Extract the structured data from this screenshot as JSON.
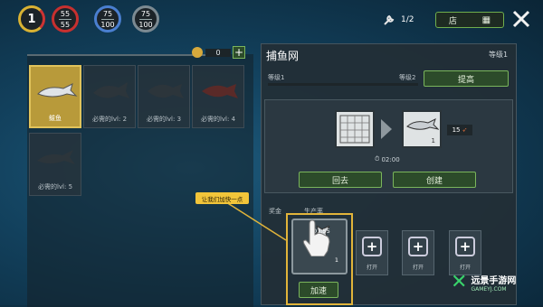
{
  "stats": {
    "level": "1",
    "health": {
      "current": "55",
      "max": "55"
    },
    "food": {
      "current": "75",
      "max": "100"
    },
    "water": {
      "current": "75",
      "max": "100"
    }
  },
  "top": {
    "tools_count": "1/2",
    "store_label": "店"
  },
  "inventory": {
    "coins": "0",
    "items": [
      {
        "label": "鲅鱼",
        "selected": true
      },
      {
        "label": "必需的lvl:  2",
        "selected": false
      },
      {
        "label": "必需的lvl:  3",
        "selected": false
      },
      {
        "label": "必需的lvl:  4",
        "selected": false
      },
      {
        "label": "必需的lvl:  5",
        "selected": false
      }
    ]
  },
  "craft": {
    "title": "捕鱼网",
    "level_badge": "等级1",
    "level1_label": "等级1",
    "level2_label": "等级2",
    "upgrade_button": "提高",
    "output_qty": "1",
    "output_count": "15",
    "timer": "02:00",
    "back_button": "回去",
    "create_button": "创建",
    "sub_left": "奖金",
    "sub_mid": "生产率",
    "active_slot": {
      "timer": "01:55",
      "qty": "1"
    },
    "open_label": "打开",
    "speedup_button": "加速"
  },
  "tooltip": "让我们加快一点",
  "watermark": {
    "title": "远景手游网",
    "url": "GAMEYJ.COM"
  },
  "colors": {
    "accent_green": "#7ab55c",
    "highlight_gold": "#e1c35b"
  }
}
